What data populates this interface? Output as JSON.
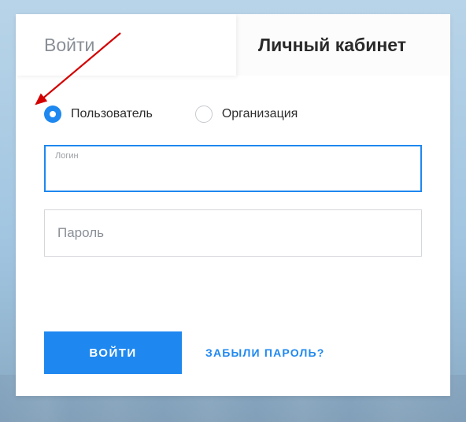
{
  "tabs": {
    "login": "Войти",
    "cabinet": "Личный кабинет"
  },
  "radios": {
    "user": "Пользователь",
    "org": "Организация"
  },
  "fields": {
    "login_label": "Логин",
    "password_placeholder": "Пароль"
  },
  "actions": {
    "submit": "ВОЙТИ",
    "forgot": "ЗАБЫЛИ ПАРОЛЬ?"
  },
  "colors": {
    "accent": "#1e88f0"
  }
}
